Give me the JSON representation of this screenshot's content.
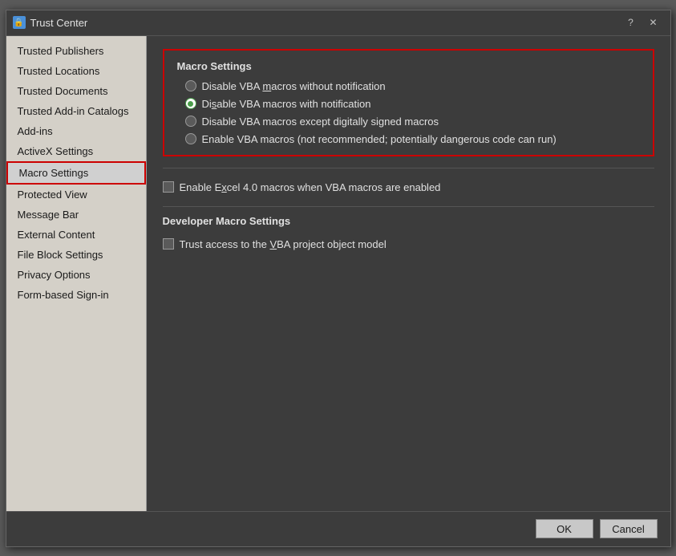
{
  "dialog": {
    "title": "Trust Center",
    "title_icon": "🔒",
    "help_button": "?",
    "close_button": "✕"
  },
  "sidebar": {
    "items": [
      {
        "label": "Trusted Publishers",
        "id": "trusted-publishers",
        "active": false
      },
      {
        "label": "Trusted Locations",
        "id": "trusted-locations",
        "active": false
      },
      {
        "label": "Trusted Documents",
        "id": "trusted-documents",
        "active": false
      },
      {
        "label": "Trusted Add-in Catalogs",
        "id": "trusted-addin-catalogs",
        "active": false
      },
      {
        "label": "Add-ins",
        "id": "add-ins",
        "active": false
      },
      {
        "label": "ActiveX Settings",
        "id": "activex-settings",
        "active": false
      },
      {
        "label": "Macro Settings",
        "id": "macro-settings",
        "active": true
      },
      {
        "label": "Protected View",
        "id": "protected-view",
        "active": false
      },
      {
        "label": "Message Bar",
        "id": "message-bar",
        "active": false
      },
      {
        "label": "External Content",
        "id": "external-content",
        "active": false
      },
      {
        "label": "File Block Settings",
        "id": "file-block-settings",
        "active": false
      },
      {
        "label": "Privacy Options",
        "id": "privacy-options",
        "active": false
      },
      {
        "label": "Form-based Sign-in",
        "id": "form-based-signin",
        "active": false
      }
    ]
  },
  "content": {
    "macro_settings_title": "Macro Settings",
    "radio_options": [
      {
        "id": "disable-no-notify",
        "label": "Disable VBA macros without notification",
        "underline_char": "m",
        "selected": false
      },
      {
        "id": "disable-notify",
        "label": "Disable VBA macros with notification",
        "underline_char": "s",
        "selected": true
      },
      {
        "id": "disable-signed",
        "label": "Disable VBA macros except digitally signed macros",
        "underline_char": "",
        "selected": false
      },
      {
        "id": "enable-macros",
        "label": "Enable VBA macros (not recommended; potentially dangerous code can run)",
        "underline_char": "",
        "selected": false
      }
    ],
    "excel_macro_label": "Enable Excel 4.0 macros when VBA macros are enabled",
    "excel_macro_underline": "x",
    "developer_title": "Developer Macro Settings",
    "vba_trust_label": "Trust access to the VBA project object model",
    "vba_trust_underline": "V"
  },
  "footer": {
    "ok_label": "OK",
    "cancel_label": "Cancel"
  }
}
